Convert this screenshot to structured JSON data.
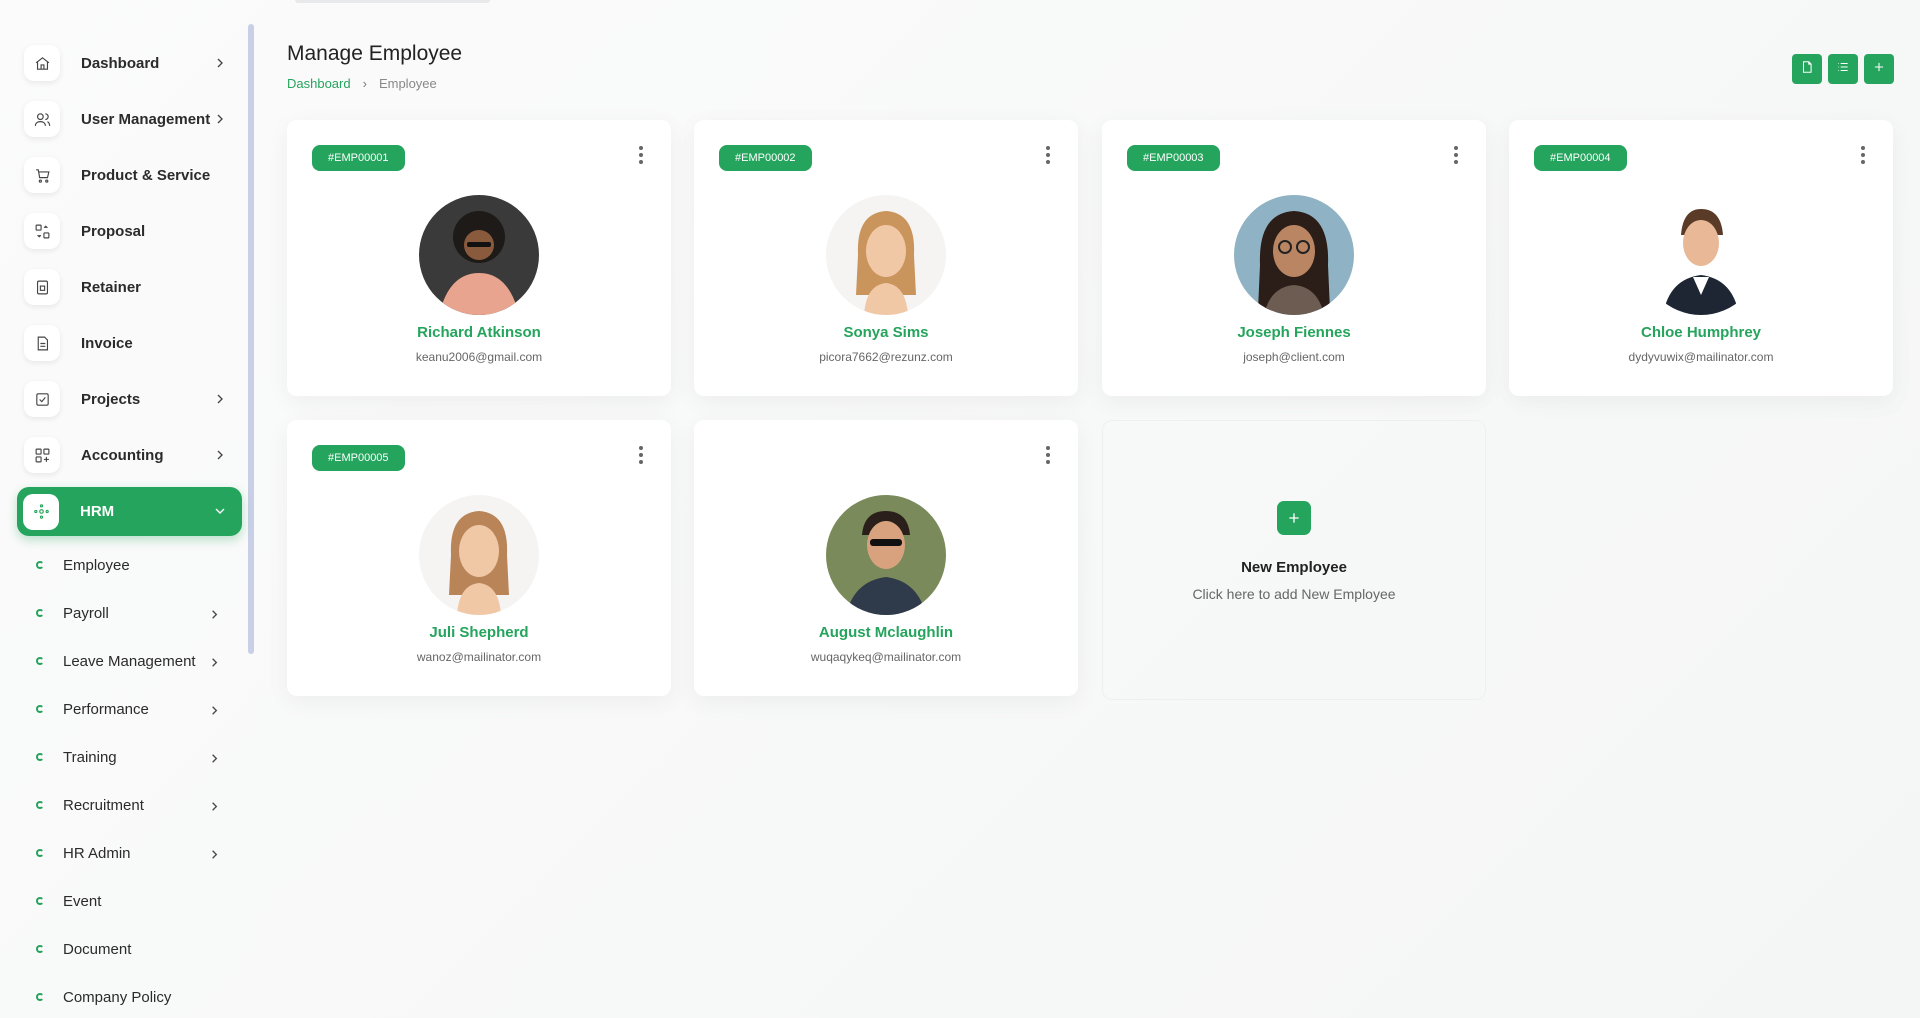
{
  "sidebar": {
    "items": [
      {
        "label": "Dashboard",
        "icon": "home-icon",
        "chevron": true
      },
      {
        "label": "User Management",
        "icon": "users-icon",
        "chevron": true
      },
      {
        "label": "Product & Service",
        "icon": "cart-icon",
        "chevron": false
      },
      {
        "label": "Proposal",
        "icon": "proposal-icon",
        "chevron": false
      },
      {
        "label": "Retainer",
        "icon": "retainer-icon",
        "chevron": false
      },
      {
        "label": "Invoice",
        "icon": "invoice-icon",
        "chevron": false
      },
      {
        "label": "Projects",
        "icon": "projects-icon",
        "chevron": true
      },
      {
        "label": "Accounting",
        "icon": "accounting-icon",
        "chevron": true
      },
      {
        "label": "HRM",
        "icon": "hrm-icon",
        "chevron": true,
        "active": true
      }
    ],
    "subitems": [
      {
        "label": "Employee",
        "chevron": false
      },
      {
        "label": "Payroll",
        "chevron": true
      },
      {
        "label": "Leave Management",
        "chevron": true
      },
      {
        "label": "Performance",
        "chevron": true
      },
      {
        "label": "Training",
        "chevron": true
      },
      {
        "label": "Recruitment",
        "chevron": true
      },
      {
        "label": "HR Admin",
        "chevron": true
      },
      {
        "label": "Event",
        "chevron": false
      },
      {
        "label": "Document",
        "chevron": false
      },
      {
        "label": "Company Policy",
        "chevron": false
      }
    ]
  },
  "header": {
    "title": "Manage Employee",
    "breadcrumb": {
      "home": "Dashboard",
      "current": "Employee"
    },
    "toolbar": [
      "export-icon",
      "list-icon",
      "plus-icon"
    ]
  },
  "employees": [
    {
      "id": "#EMP00001",
      "name": "Richard Atkinson",
      "email": "keanu2006@gmail.com"
    },
    {
      "id": "#EMP00002",
      "name": "Sonya Sims",
      "email": "picora7662@rezunz.com"
    },
    {
      "id": "#EMP00003",
      "name": "Joseph Fiennes",
      "email": "joseph@client.com"
    },
    {
      "id": "#EMP00004",
      "name": "Chloe Humphrey",
      "email": "dydyvuwix@mailinator.com"
    },
    {
      "id": "#EMP00005",
      "name": "Juli Shepherd",
      "email": "wanoz@mailinator.com"
    },
    {
      "id": "",
      "name": "August Mclaughlin",
      "email": "wuqaqykeq@mailinator.com"
    }
  ],
  "new_employee": {
    "title": "New Employee",
    "subtitle": "Click here to add New Employee"
  },
  "colors": {
    "accent": "#24a45c"
  }
}
